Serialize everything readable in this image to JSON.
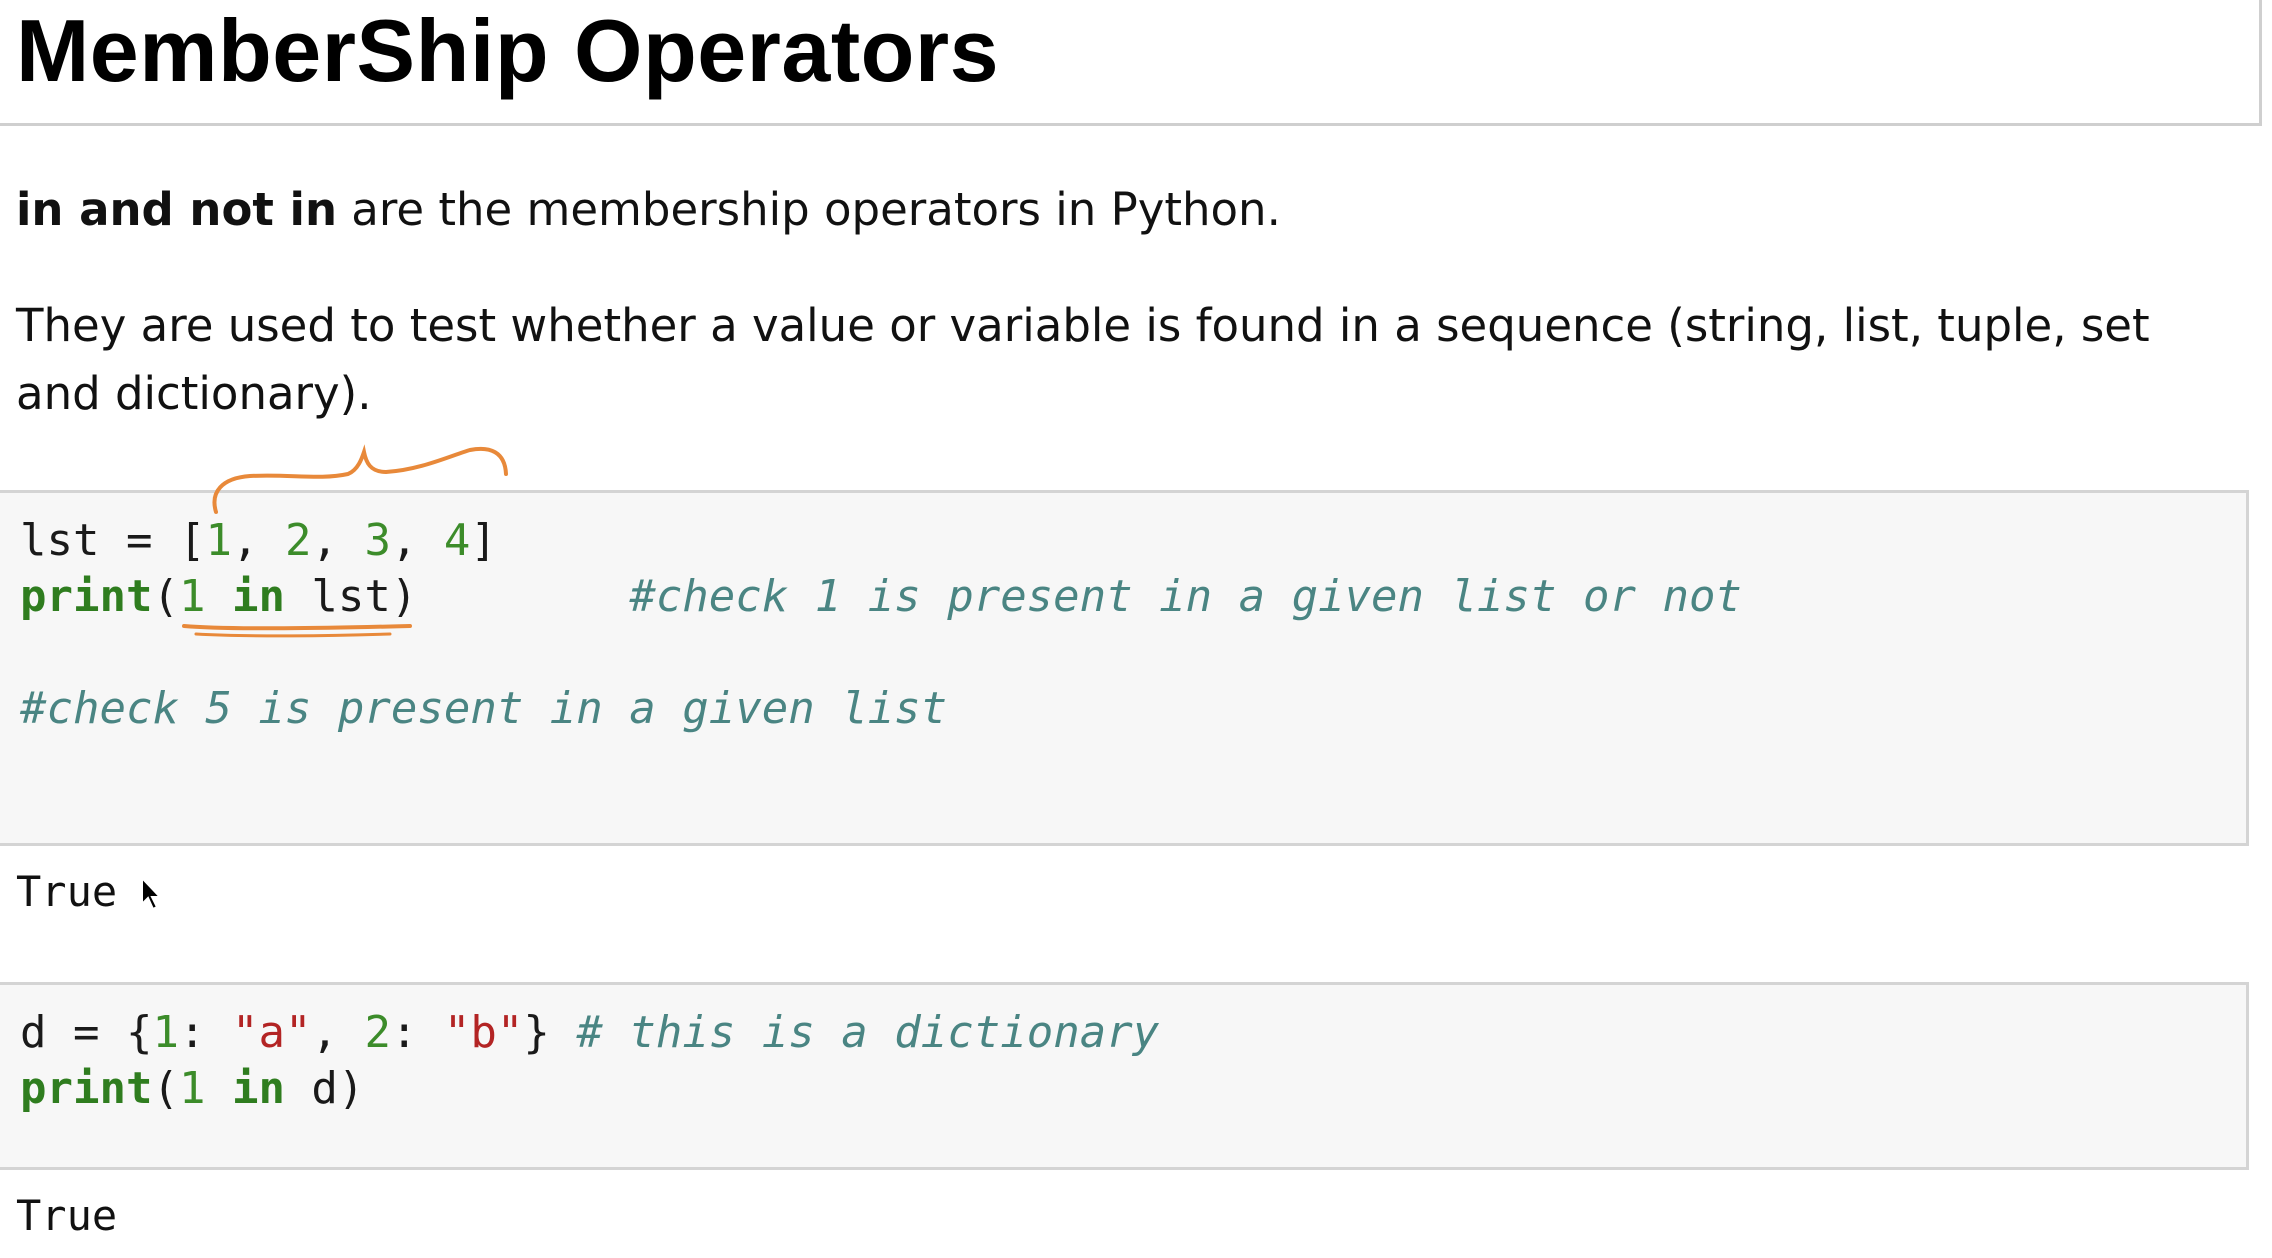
{
  "heading": "MemberShip Operators",
  "intro": {
    "bold": "in and not in",
    "rest": " are the membership operators in Python."
  },
  "description": "They are used to test whether a value or variable is found in a sequence (string, list, tuple, set and dictionary).",
  "cell1": {
    "line1": {
      "var": "lst",
      "eq": " = ",
      "open": "[",
      "n1": "1",
      "s1": ", ",
      "n2": "2",
      "s2": ", ",
      "n3": "3",
      "s3": ", ",
      "n4": "4",
      "close": "]"
    },
    "line2": {
      "fn": "print",
      "open": "(",
      "num": "1",
      "sp1": " ",
      "kw": "in",
      "arg": " lst",
      "close": ")",
      "gap": "        ",
      "comment": "#check 1 is present in a given list or not"
    },
    "line4": {
      "comment": "#check 5 is present in a given list"
    },
    "output": "True"
  },
  "cell2": {
    "line1": {
      "var": "d",
      "eq": " = ",
      "open": "{",
      "k1": "1",
      "c1": ": ",
      "v1": "\"a\"",
      "s1": ", ",
      "k2": "2",
      "c2": ": ",
      "v2": "\"b\"",
      "close": "}",
      "sp": " ",
      "comment": "# this is a dictionary"
    },
    "line2": {
      "fn": "print",
      "open": "(",
      "num": "1",
      "sp1": " ",
      "kw": "in",
      "arg": " d",
      "close": ")"
    },
    "output": "True"
  },
  "colors": {
    "keyword": "#2f7d1f",
    "number": "#3c8c2a",
    "string": "#b32424",
    "comment": "#4a8583",
    "annotation": "#e8893a",
    "cell_bg": "#f7f7f7"
  }
}
